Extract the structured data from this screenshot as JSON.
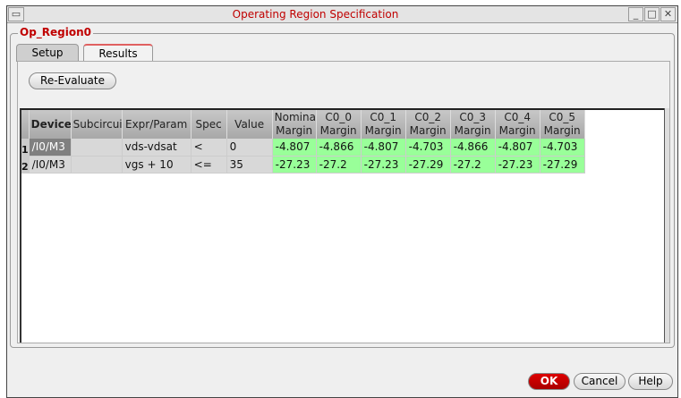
{
  "window": {
    "title": "Operating Region Specification",
    "minimize": "_",
    "maximize": "□",
    "close": "✕",
    "menu": "▭"
  },
  "group_label": "Op_Region0",
  "tabs": [
    {
      "label": "Setup"
    },
    {
      "label": "Results"
    }
  ],
  "reevaluate_label": "Re-Evaluate",
  "table": {
    "headers": [
      [
        "Device",
        ""
      ],
      [
        "Subcircuit",
        ""
      ],
      [
        "Expr/Param",
        ""
      ],
      [
        "Spec",
        ""
      ],
      [
        "Value",
        ""
      ],
      [
        "Nominal",
        "Margin"
      ],
      [
        "C0_0",
        "Margin"
      ],
      [
        "C0_1",
        "Margin"
      ],
      [
        "C0_2",
        "Margin"
      ],
      [
        "C0_3",
        "Margin"
      ],
      [
        "C0_4",
        "Margin"
      ],
      [
        "C0_5",
        "Margin"
      ]
    ],
    "rows": [
      {
        "num": "1",
        "cells": [
          "/I0/M3",
          "",
          "vds-vdsat",
          "<",
          "0",
          "-4.807",
          "-4.866",
          "-4.807",
          "-4.703",
          "-4.866",
          "-4.807",
          "-4.703"
        ]
      },
      {
        "num": "2",
        "cells": [
          "/I0/M3",
          "",
          "vgs + 10",
          "<=",
          "35",
          "-27.23",
          "-27.2",
          "-27.23",
          "-27.29",
          "-27.2",
          "-27.23",
          "-27.29"
        ]
      }
    ]
  },
  "buttons": {
    "ok": "OK",
    "cancel": "Cancel",
    "help": "Help"
  }
}
